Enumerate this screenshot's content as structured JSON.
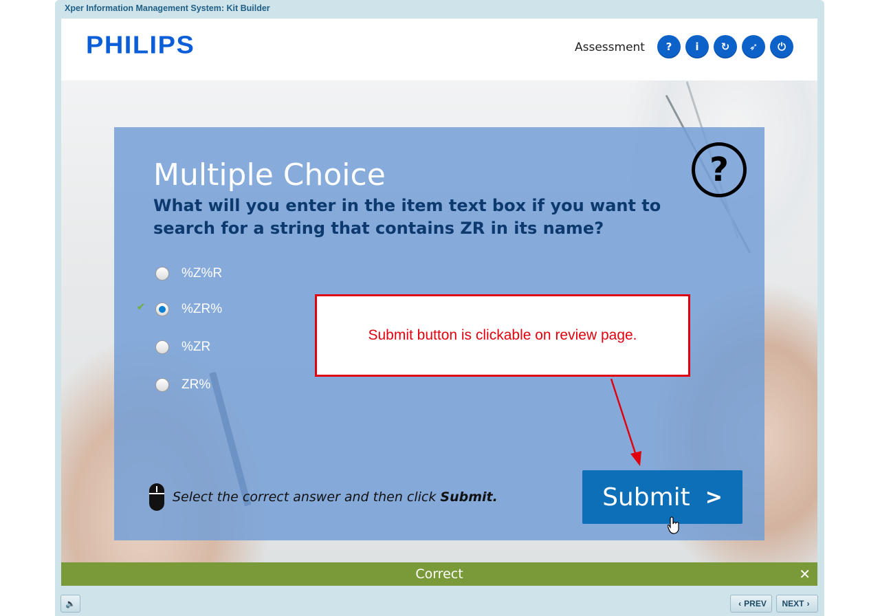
{
  "window": {
    "title": "Xper Information Management System: Kit Builder"
  },
  "header": {
    "logo": "PHILIPS",
    "section": "Assessment",
    "buttons": [
      {
        "name": "help",
        "glyph": "?"
      },
      {
        "name": "info",
        "glyph": "i"
      },
      {
        "name": "replay",
        "glyph": "↻"
      },
      {
        "name": "compass",
        "glyph": "➶"
      },
      {
        "name": "power",
        "glyph": "⏻"
      }
    ]
  },
  "question": {
    "badge": "?",
    "title": "Multiple Choice",
    "text": "What will you enter in the item text box if you want to search for a string that contains ZR in its name?",
    "options": [
      {
        "label": "%Z%R",
        "selected": false
      },
      {
        "label": "%ZR%",
        "selected": true
      },
      {
        "label": "%ZR",
        "selected": false
      },
      {
        "label": "ZR%",
        "selected": false
      }
    ],
    "correct_mark": "✔",
    "instruction_prefix": "Select the correct answer and then click ",
    "instruction_strong": "Submit.",
    "submit_label": "Submit",
    "submit_chevron": ">"
  },
  "callout": {
    "text": "Submit button is clickable on review page.",
    "color": "#e0000d"
  },
  "feedback": {
    "text": "Correct",
    "close": "✕",
    "color": "#7a9a3a"
  },
  "footer": {
    "audio_icon": "🔈",
    "prev": "PREV",
    "next": "NEXT",
    "prev_chevron": "‹",
    "next_chevron": "›"
  }
}
